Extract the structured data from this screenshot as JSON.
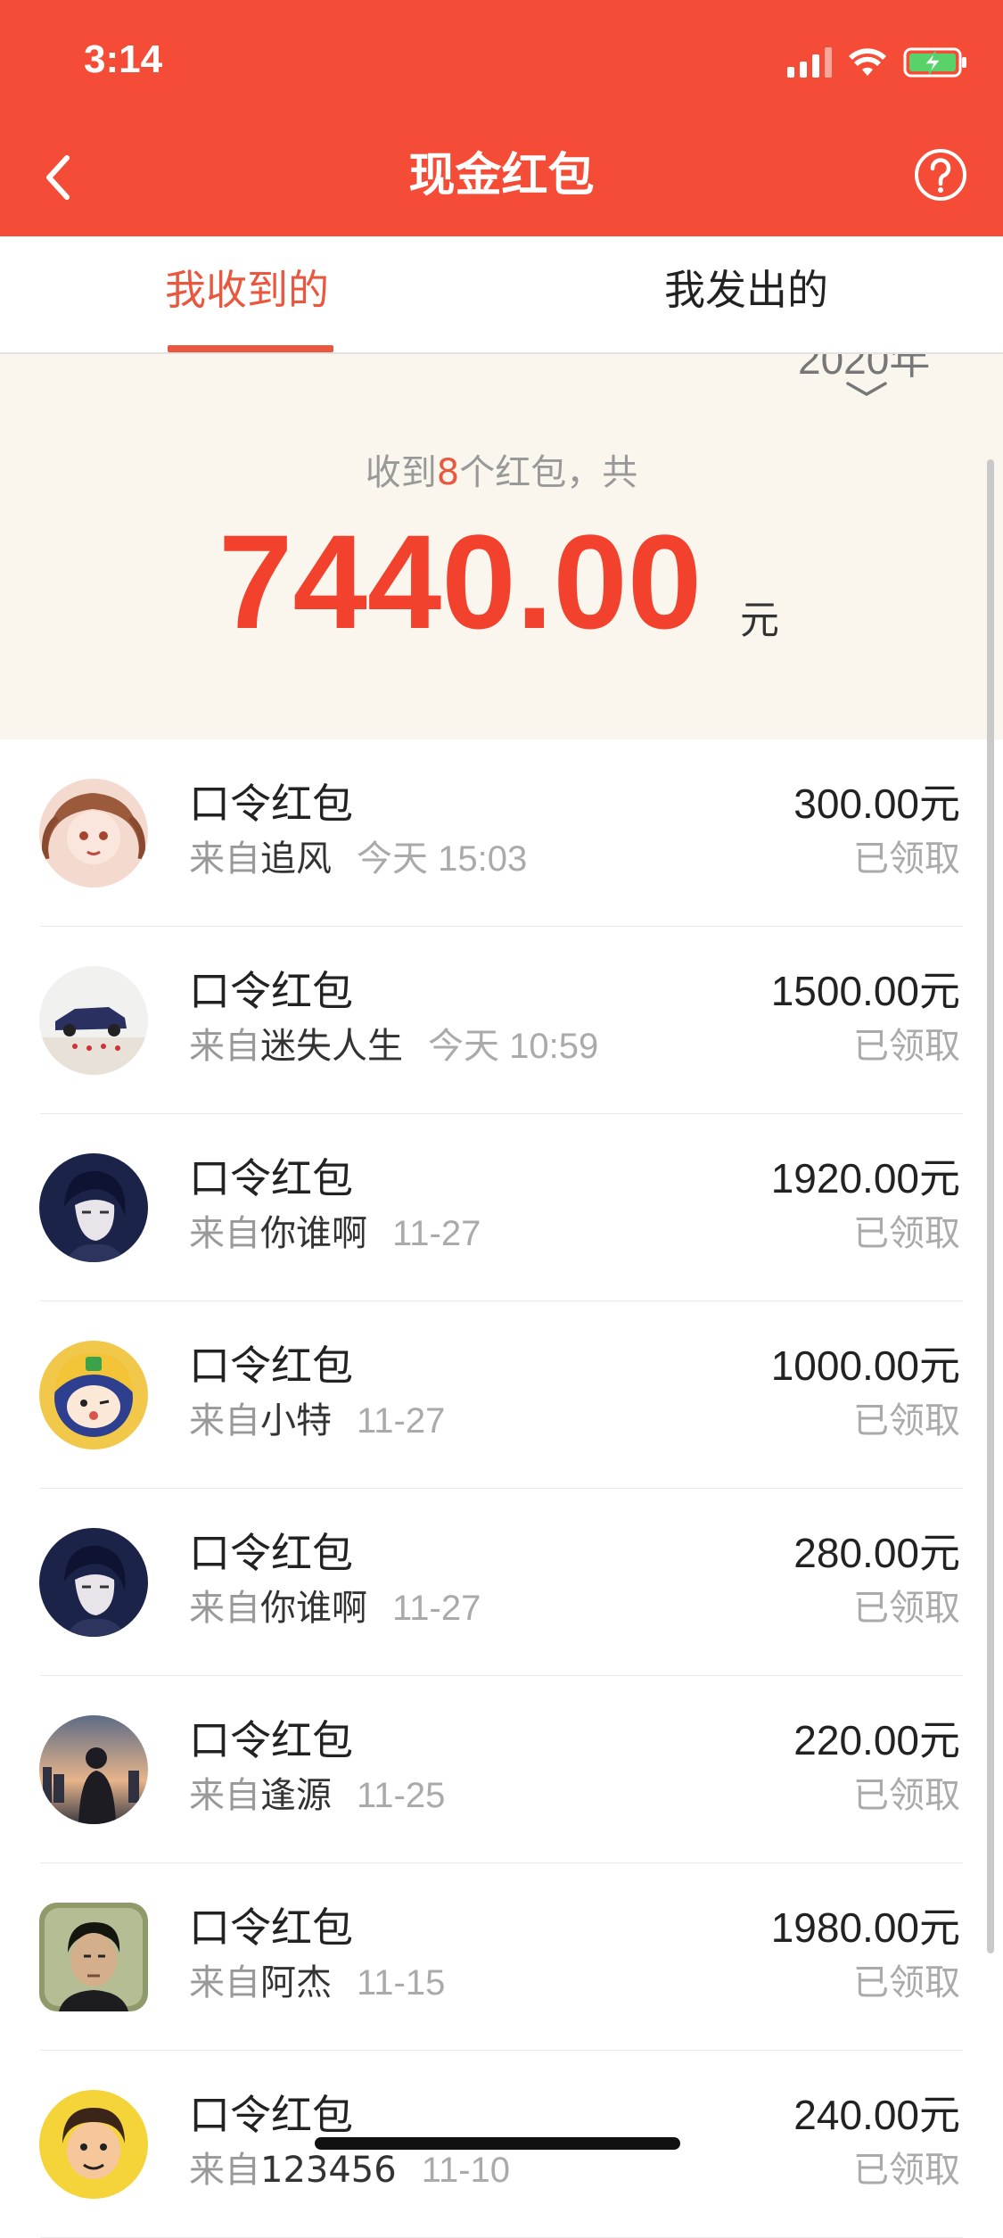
{
  "status_bar": {
    "time": "3:14"
  },
  "nav": {
    "title": "现金红包"
  },
  "tabs": [
    {
      "label": "我收到的"
    },
    {
      "label": "我发出的"
    }
  ],
  "summary": {
    "year": "2020年",
    "prefix": "收到",
    "count": "8",
    "suffix": "个红包，共",
    "total": "7440.00",
    "unit": "元"
  },
  "records": [
    {
      "title": "口令红包",
      "from": "来自",
      "name": "追风",
      "time": "今天 15:03",
      "amount": "300.00",
      "unit": "元",
      "status": "已领取"
    },
    {
      "title": "口令红包",
      "from": "来自",
      "name": "迷失人生",
      "time": "今天 10:59",
      "amount": "1500.00",
      "unit": "元",
      "status": "已领取"
    },
    {
      "title": "口令红包",
      "from": "来自",
      "name": "你谁啊",
      "time": "11-27",
      "amount": "1920.00",
      "unit": "元",
      "status": "已领取"
    },
    {
      "title": "口令红包",
      "from": "来自",
      "name": "小特",
      "time": "11-27",
      "amount": "1000.00",
      "unit": "元",
      "status": "已领取"
    },
    {
      "title": "口令红包",
      "from": "来自",
      "name": "你谁啊",
      "time": "11-27",
      "amount": "280.00",
      "unit": "元",
      "status": "已领取"
    },
    {
      "title": "口令红包",
      "from": "来自",
      "name": "逢源",
      "time": "11-25",
      "amount": "220.00",
      "unit": "元",
      "status": "已领取"
    },
    {
      "title": "口令红包",
      "from": "来自",
      "name": "阿杰",
      "time": "11-15",
      "amount": "1980.00",
      "unit": "元",
      "status": "已领取"
    },
    {
      "title": "口令红包",
      "from": "来自",
      "name": "123456",
      "time": "11-10",
      "amount": "240.00",
      "unit": "元",
      "status": "已领取"
    }
  ],
  "colors": {
    "brand_red": "#f44c36",
    "accent_red": "#e9573f",
    "summary_bg": "#faf6ee"
  },
  "icons": {
    "back": "chevron-left-icon",
    "help": "question-circle-icon",
    "year_toggle": "chevron-down-icon"
  }
}
